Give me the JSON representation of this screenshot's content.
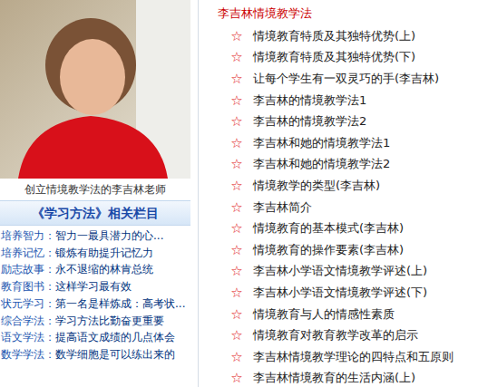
{
  "photo": {
    "caption": "创立情境教学法的李吉林老师"
  },
  "sidebar": {
    "title": "《学习方法》相关栏目",
    "items": [
      {
        "category": "培养智力：",
        "title": "智力一最具潜力的心..."
      },
      {
        "category": "培养记忆：",
        "title": "锻炼有助提升记忆力"
      },
      {
        "category": "励志故事：",
        "title": "永不退缩的林肯总统"
      },
      {
        "category": "教育图书：",
        "title": "这样学习最有效"
      },
      {
        "category": "状元学习：",
        "title": "第一名是样炼成：高考状..."
      },
      {
        "category": "综合学法：",
        "title": "学习方法比勤奋更重要"
      },
      {
        "category": "语文学法：",
        "title": "提高语文成绩的几点体会"
      },
      {
        "category": "数学学法：",
        "title": "数学细胞是可以练出来的"
      }
    ]
  },
  "article_list": {
    "title": "李吉林情境教学法",
    "bullet": "☆",
    "items": [
      "情境教育特质及其独特优势(上)",
      "情境教育特质及其独特优势(下)",
      "让每个学生有一双灵巧的手(李吉林)",
      "李吉林的情境教学法1",
      "李吉林的情境教学法2",
      "李吉林和她的情境教学法1",
      "李吉林和她的情境教学法2",
      "情境教学的类型(李吉林)",
      "李吉林简介",
      "情境教育的基本模式(李吉林)",
      "情境教育的操作要素(李吉林)",
      "李吉林小学语文情境教学评述(上)",
      "李吉林小学语文情境教学评述(下)",
      "情境教育与人的情感性素质",
      "情境教育对教育教学改革的启示",
      "李吉林情境教学理论的四特点和五原则",
      "李吉林情境教育的生活内涵(上)"
    ]
  }
}
